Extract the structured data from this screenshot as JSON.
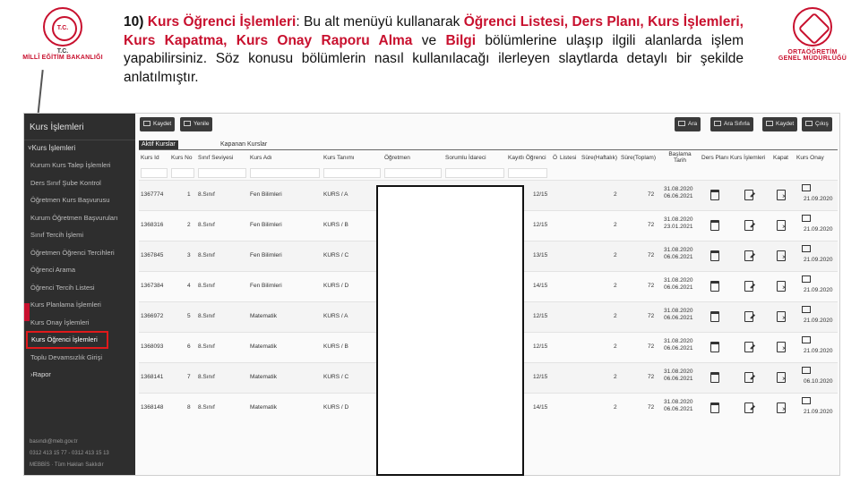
{
  "logos": {
    "left_line1": "T.C.",
    "left_line2": "MİLLÎ EĞİTİM BAKANLIĞI",
    "right_line1": "ORTAÖĞRETİM",
    "right_line2": "GENEL MÜDÜRLÜĞÜ"
  },
  "intro": {
    "num": "10)",
    "title": "Kurs Öğrenci İşlemleri",
    "t1": ": Bu alt menüyü kullanarak ",
    "i1": "Öğrenci Listesi, Ders Planı, Kurs İşlemleri, Kurs Kapatma, Kurs Onay Raporu Alma",
    "t2": " ve ",
    "i2": "Bilgi",
    "t3": " bölümlerine ulaşıp ilgili alanlarda işlem yapabilirsiniz. Söz konusu bölümlerin nasıl kullanılacağı ilerleyen slaytlarda detaylı bir şekilde anlatılmıştır."
  },
  "sidebar": {
    "title": "Kurs İşlemleri",
    "section": "Kurs İşlemleri",
    "items": [
      "Kurum Kurs Talep İşlemleri",
      "Ders Sınıf Şube Kontrol",
      "Öğretmen Kurs Başvurusu",
      "Kurum Öğretmen Başvuruları",
      "Sınıf Tercih İşlemi",
      "Öğretmen Öğrenci Tercihleri",
      "Öğrenci Arama",
      "Öğrenci Tercih Listesi",
      "Kurs Planlama İşlemleri",
      "Kurs Onay İşlemleri",
      "Kurs Öğrenci İşlemleri",
      "Toplu Devamsızlık Girişi"
    ],
    "rapor": "Rapor",
    "footer1": "basındı@meb.gov.tr",
    "footer2": "0312 413 15 77 - 0312 413 15 13",
    "footer3": "MEBBİS · Tüm Hakları Saklıdır"
  },
  "toolbar": {
    "new_label": "Kaydet",
    "delete_label": "Yenile",
    "search_label": "Ara",
    "search_clear_label": "Ara Sıfırla",
    "save_label": "Kaydet",
    "exit_label": "Çıkış"
  },
  "tabs": [
    "Aktif Kurslar",
    "Kapanan Kurslar"
  ],
  "columns": [
    "Kurs Id",
    "Kurs No",
    "Sınıf Seviyesi",
    "Kurs Adı",
    "Kurs Tanımı",
    "Öğretmen",
    "Sorumlu İdareci",
    "Kayıtlı Öğrenci",
    "Ö",
    "Listesi",
    "Süre(Haftalık)",
    "Süre(Toplam)",
    "Başlama Tarih",
    "Ders Planı",
    "Kurs İşlemleri",
    "Kapat",
    "Kurs Onay"
  ],
  "rows": [
    {
      "id": "1367774",
      "no": "1",
      "level": "8.Sınıf",
      "name": "Fen Bilimleri",
      "def": "KURS / A",
      "count": "12/15",
      "weekly": "2",
      "total": "72",
      "start": "31.08.2020",
      "end": "06.06.2021",
      "approve": "21.09.2020"
    },
    {
      "id": "1368316",
      "no": "2",
      "level": "8.Sınıf",
      "name": "Fen Bilimleri",
      "def": "KURS / B",
      "count": "12/15",
      "weekly": "2",
      "total": "72",
      "start": "31.08.2020",
      "end": "23.01.2021",
      "approve": "21.09.2020"
    },
    {
      "id": "1367845",
      "no": "3",
      "level": "8.Sınıf",
      "name": "Fen Bilimleri",
      "def": "KURS / C",
      "count": "13/15",
      "weekly": "2",
      "total": "72",
      "start": "31.08.2020",
      "end": "06.06.2021",
      "approve": "21.09.2020"
    },
    {
      "id": "1367384",
      "no": "4",
      "level": "8.Sınıf",
      "name": "Fen Bilimleri",
      "def": "KURS / D",
      "count": "14/15",
      "weekly": "2",
      "total": "72",
      "start": "31.08.2020",
      "end": "06.06.2021",
      "approve": "21.09.2020"
    },
    {
      "id": "1366972",
      "no": "5",
      "level": "8.Sınıf",
      "name": "Matematik",
      "def": "KURS / A",
      "count": "12/15",
      "weekly": "2",
      "total": "72",
      "start": "31.08.2020",
      "end": "06.06.2021",
      "approve": "21.09.2020"
    },
    {
      "id": "1368093",
      "no": "6",
      "level": "8.Sınıf",
      "name": "Matematik",
      "def": "KURS / B",
      "count": "12/15",
      "weekly": "2",
      "total": "72",
      "start": "31.08.2020",
      "end": "06.06.2021",
      "approve": "21.09.2020"
    },
    {
      "id": "1368141",
      "no": "7",
      "level": "8.Sınıf",
      "name": "Matematik",
      "def": "KURS / C",
      "count": "12/15",
      "weekly": "2",
      "total": "72",
      "start": "31.08.2020",
      "end": "06.06.2021",
      "approve": "06.10.2020"
    },
    {
      "id": "1368148",
      "no": "8",
      "level": "8.Sınıf",
      "name": "Matematik",
      "def": "KURS / D",
      "count": "14/15",
      "weekly": "2",
      "total": "72",
      "start": "31.08.2020",
      "end": "06.06.2021",
      "approve": "21.09.2020"
    }
  ]
}
